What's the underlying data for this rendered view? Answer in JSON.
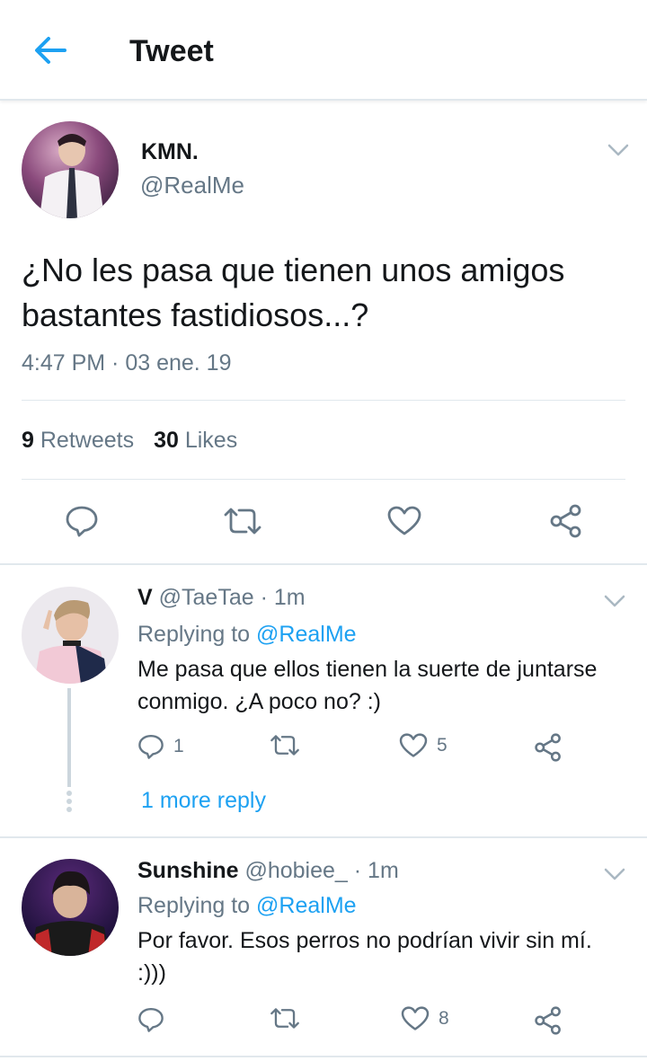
{
  "header": {
    "title": "Tweet"
  },
  "tweet": {
    "name": "KMN.",
    "handle": "@RealMe",
    "text": "¿No les pasa que tienen unos amigos bastantes fastidiosos...?",
    "time": "4:47 PM · 03 ene. 19",
    "retweets_count": "9",
    "retweets_label": "Retweets",
    "likes_count": "30",
    "likes_label": "Likes"
  },
  "replies": [
    {
      "name": "V",
      "handle": "@TaeTae",
      "time": " · 1m",
      "replying_label": "Replying to ",
      "replying_to": "@RealMe",
      "text": "Me pasa que ellos tienen la suerte de juntarse conmigo. ¿A poco no? :)",
      "reply_count": "1",
      "like_count": "5",
      "more_replies": "1 more reply"
    },
    {
      "name": "Sunshine",
      "handle": "@hobiee_",
      "time": " · 1m",
      "replying_label": "Replying to ",
      "replying_to": "@RealMe",
      "text": "Por favor. Esos perros no podrían vivir sin mí. :)))",
      "reply_count": "",
      "like_count": "8"
    }
  ],
  "colors": {
    "accent": "#1da1f2",
    "secondary_text": "#657786",
    "divider": "#e1e8ed",
    "icon": "#657786"
  },
  "icons": [
    "back-arrow-icon",
    "chevron-down-icon",
    "reply-icon",
    "retweet-icon",
    "heart-icon",
    "share-icon"
  ]
}
